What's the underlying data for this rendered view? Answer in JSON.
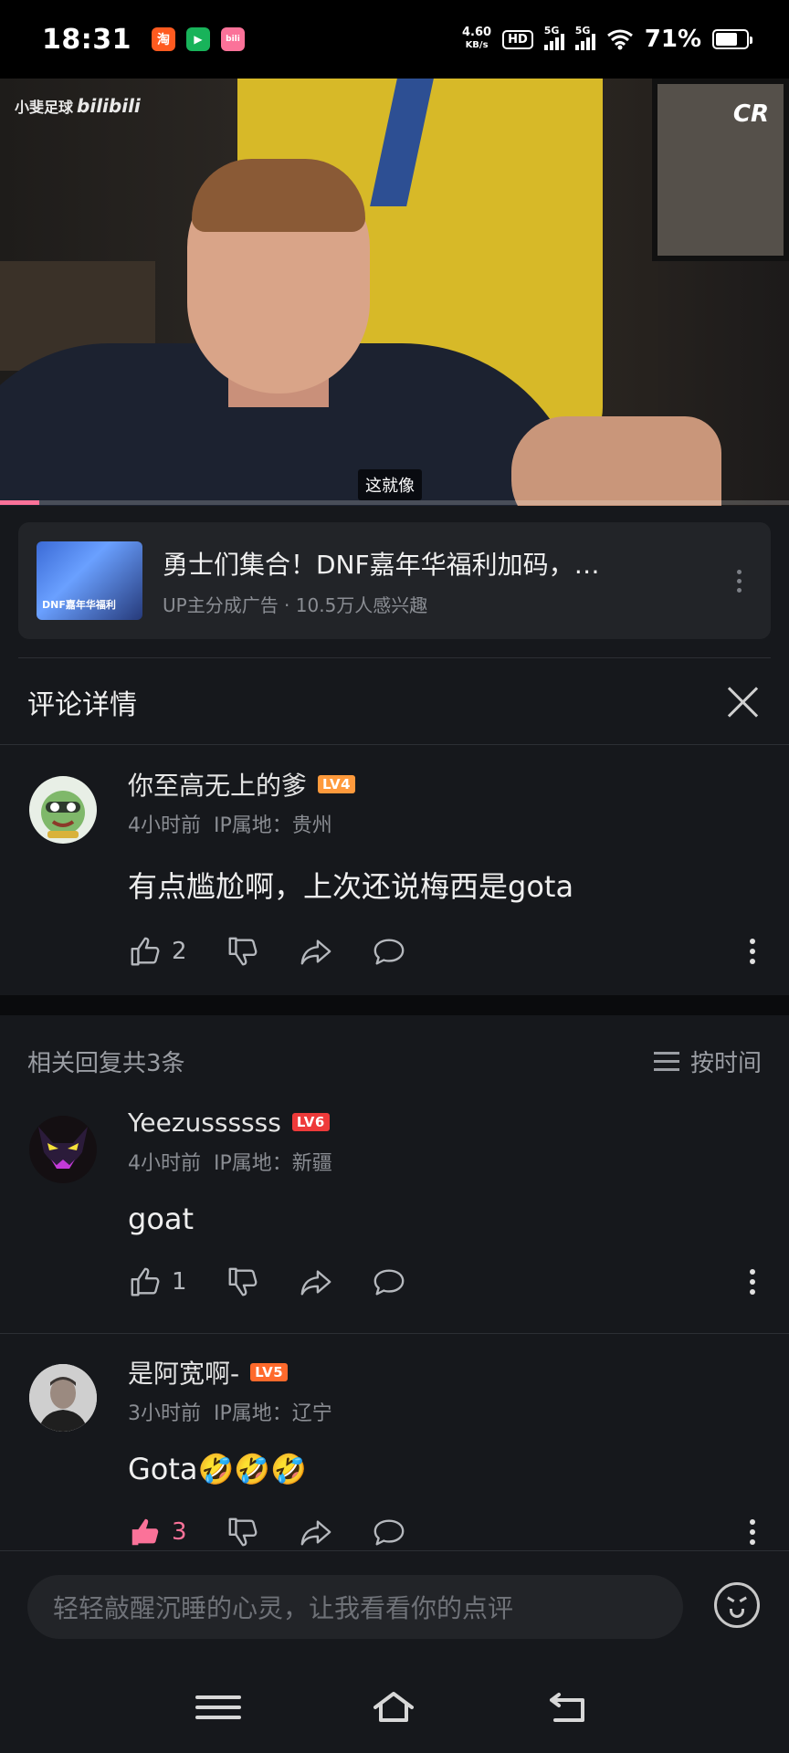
{
  "status_bar": {
    "time": "18:31",
    "app_icons": [
      "淘",
      "▶",
      "bili"
    ],
    "net_speed_value": "4.60",
    "net_speed_unit": "KB/s",
    "hd_label": "HD",
    "sim1_label": "5G",
    "sim2_label": "5G",
    "battery_percent": "71%",
    "battery_level": 0.71
  },
  "video": {
    "watermark_channel": "小斐足球",
    "watermark_brand": "bilibili",
    "corner_logo": "CR",
    "subtitle": "这就像",
    "progress": 0.05
  },
  "ad": {
    "title": "勇士们集合！DNF嘉年华福利加码，…",
    "meta": "UP主分成广告 · 10.5万人感兴趣",
    "thumb_text": "DNF嘉年华福利",
    "more_icon": "more-vertical-icon"
  },
  "detail": {
    "title": "评论详情",
    "close_icon": "close-icon"
  },
  "main_comment": {
    "username": "你至高无上的爹",
    "level": "LV4",
    "time": "4小时前",
    "ip": "IP属地：贵州",
    "text": "有点尴尬啊，上次还说梅西是gota",
    "likes": "2"
  },
  "replies_header": {
    "count_label": "相关回复共3条",
    "sort_label": "按时间"
  },
  "replies": [
    {
      "username": "Yeezussssss",
      "level": "LV6",
      "time": "4小时前",
      "ip": "IP属地：新疆",
      "text": "goat",
      "likes": "1"
    },
    {
      "username": "是阿宽啊-",
      "level": "LV5",
      "time": "3小时前",
      "ip": "IP属地：辽宁",
      "text": "Gota🤣🤣🤣",
      "likes": "3"
    }
  ],
  "input": {
    "placeholder": "轻轻敲醒沉睡的心灵，让我看看你的点评"
  },
  "colors": {
    "accent_pink": "#fb7299",
    "background": "#16181c",
    "lv4": "#ff9a3c",
    "lv5": "#ff6a2c",
    "lv6": "#ee3a3a"
  }
}
